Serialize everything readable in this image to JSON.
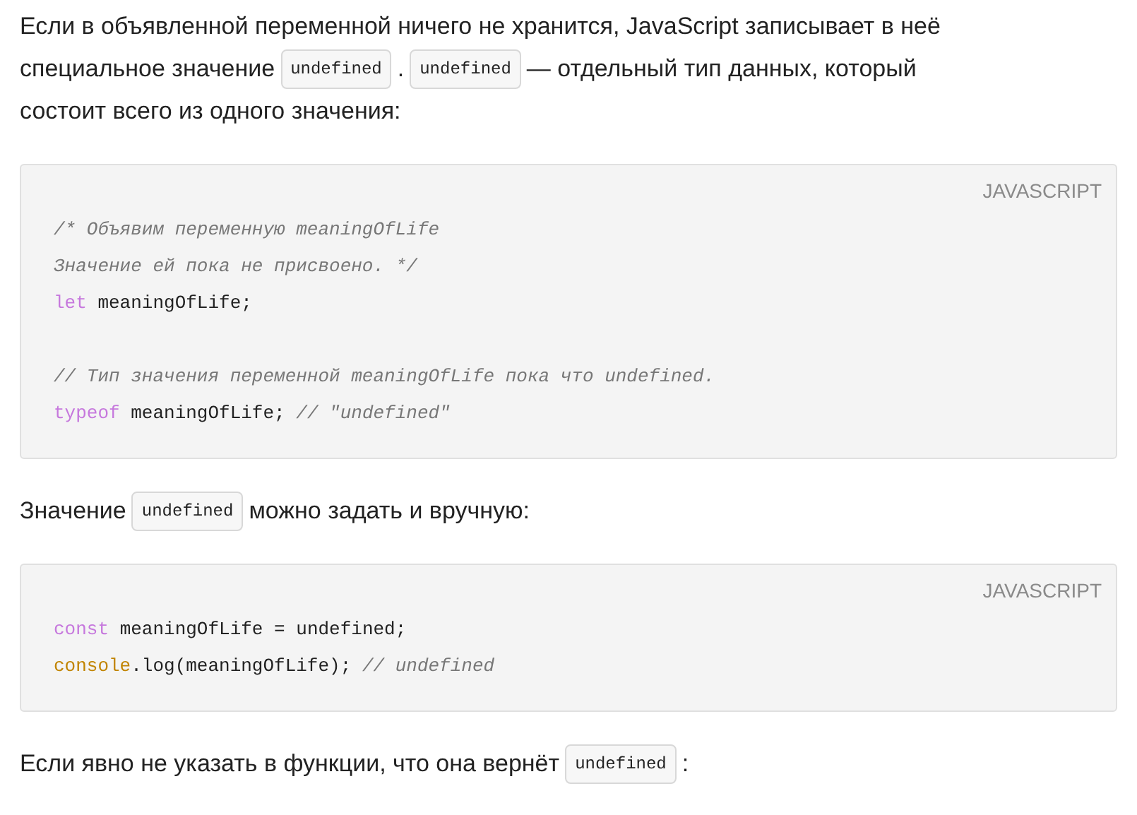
{
  "blocks": [
    {
      "kind": "paragraph",
      "parts": [
        {
          "kind": "text",
          "text": "Если в объявленной переменной ничего не хранится, JavaScript записывает в неё"
        },
        {
          "kind": "text",
          "text": "специальное значение"
        },
        {
          "kind": "code",
          "text": "undefined"
        },
        {
          "kind": "text",
          "text": "."
        },
        {
          "kind": "code",
          "text": "undefined"
        },
        {
          "kind": "text",
          "text": "— отдельный тип данных, который"
        },
        {
          "kind": "text",
          "text": "состоит всего из одного значения:"
        }
      ]
    },
    {
      "kind": "code",
      "language": "JAVASCRIPT",
      "lines": [
        [
          {
            "kind": "comment",
            "text": "/* Объявим переменную meaningOfLife"
          }
        ],
        [
          {
            "kind": "comment",
            "text": "Значение ей пока не присвоено. */"
          }
        ],
        [
          {
            "kind": "keyword",
            "text": "let"
          },
          {
            "kind": "plain",
            "text": " meaningOfLife;"
          }
        ],
        [
          {
            "kind": "blank"
          }
        ],
        [
          {
            "kind": "comment",
            "text": "// Тип значения переменной meaningOfLife пока что undefined."
          }
        ],
        [
          {
            "kind": "keyword",
            "text": "typeof"
          },
          {
            "kind": "plain",
            "text": " meaningOfLife; "
          },
          {
            "kind": "comment",
            "text": "// \"undefined\""
          }
        ]
      ]
    },
    {
      "kind": "paragraph",
      "parts": [
        {
          "kind": "text",
          "text": "Значение"
        },
        {
          "kind": "code",
          "text": "undefined"
        },
        {
          "kind": "text",
          "text": "можно задать и вручную:"
        }
      ]
    },
    {
      "kind": "code",
      "language": "JAVASCRIPT",
      "lines": [
        [
          {
            "kind": "keyword",
            "text": "const"
          },
          {
            "kind": "plain",
            "text": " meaningOfLife = undefined;"
          }
        ],
        [
          {
            "kind": "object",
            "text": "console"
          },
          {
            "kind": "plain",
            "text": ".log(meaningOfLife); "
          },
          {
            "kind": "comment",
            "text": "// undefined"
          }
        ]
      ]
    },
    {
      "kind": "paragraph",
      "parts": [
        {
          "kind": "text",
          "text": "Если явно не указать в функции, что она вернёт"
        },
        {
          "kind": "code",
          "text": "undefined"
        },
        {
          "kind": "text",
          "text": ":"
        }
      ]
    }
  ]
}
